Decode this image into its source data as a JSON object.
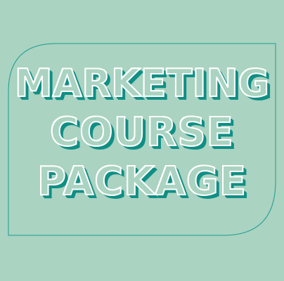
{
  "title": {
    "lines": [
      "MARKETING",
      "COURSE",
      "PACKAGE"
    ]
  },
  "colors": {
    "background": "#aad3c1",
    "frame_stroke": "#1a9c90",
    "text_highlight": "#ffffff",
    "text_shadow": "#0f8f85"
  }
}
